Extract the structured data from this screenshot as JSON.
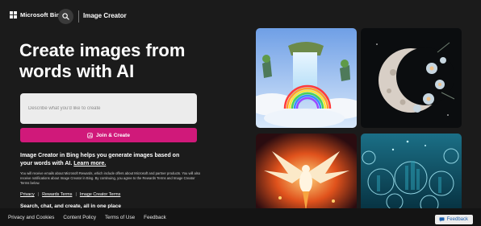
{
  "header": {
    "brand": "Microsoft Bing",
    "product": "Image Creator",
    "search_icon": "search-icon"
  },
  "hero": {
    "headline": "Create images from words with AI",
    "prompt_placeholder": "Describe what you'd like to create",
    "join_button": "Join & Create",
    "join_icon": "image-create-icon",
    "description": "Image Creator in Bing helps you generate images based on your words with AI.",
    "learn_more": "Learn more.",
    "fineprint": "You will receive emails about Microsoft Rewards, which include offers about Microsoft and partner products. You will also receive notifications about Image Creator in Bing. By continuing, you agree to the Rewards Terms and Image Creator Terms below.",
    "legal_links": [
      "Privacy",
      "Rewards Terms",
      "Image Creator Terms"
    ],
    "partial_line": "Search, chat, and create, all in one place"
  },
  "gallery": {
    "images": [
      "Fantasy waterfall with a rainbow and floating islands",
      "Crescent moon decorated with flowers",
      "Fiery phoenix bird",
      "Underwater city in glass bubbles"
    ]
  },
  "footer": {
    "links": [
      "Privacy and Cookies",
      "Content Policy",
      "Terms of Use",
      "Feedback"
    ],
    "feedback_button": "Feedback"
  },
  "colors": {
    "background": "#1b1b1b",
    "accent": "#d0197a",
    "input_bg": "#ececec"
  }
}
